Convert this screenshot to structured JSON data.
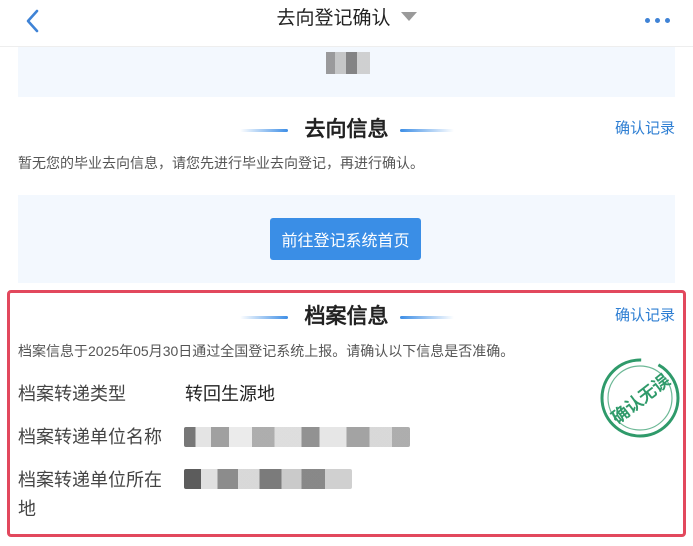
{
  "header": {
    "title": "去向登记确认",
    "back_icon": "chevron-left-icon",
    "dropdown_icon": "caret-down-icon",
    "more_icon": "more-dots-icon"
  },
  "destination": {
    "title": "去向信息",
    "record_link": "确认记录",
    "notice": "暂无您的毕业去向信息，请您先进行毕业去向登记，再进行确认。",
    "button_label": "前往登记系统首页"
  },
  "archive": {
    "title": "档案信息",
    "record_link": "确认记录",
    "notice": "档案信息于2025年05月30日通过全国登记系统上报。请确认以下信息是否准确。",
    "fields": [
      {
        "label": "档案转递类型",
        "value": "转回生源地"
      },
      {
        "label": "档案转递单位名称",
        "value": ""
      },
      {
        "label_line1": "档案转递单位所在",
        "label_line2": "地",
        "value": ""
      }
    ],
    "stamp_text": "确认无误"
  },
  "colors": {
    "accent": "#3a8ee6",
    "link": "#2f7fd3",
    "highlight_border": "#e2485d",
    "stamp": "#2f9a6a",
    "panel_bg": "#f3f8fe"
  }
}
